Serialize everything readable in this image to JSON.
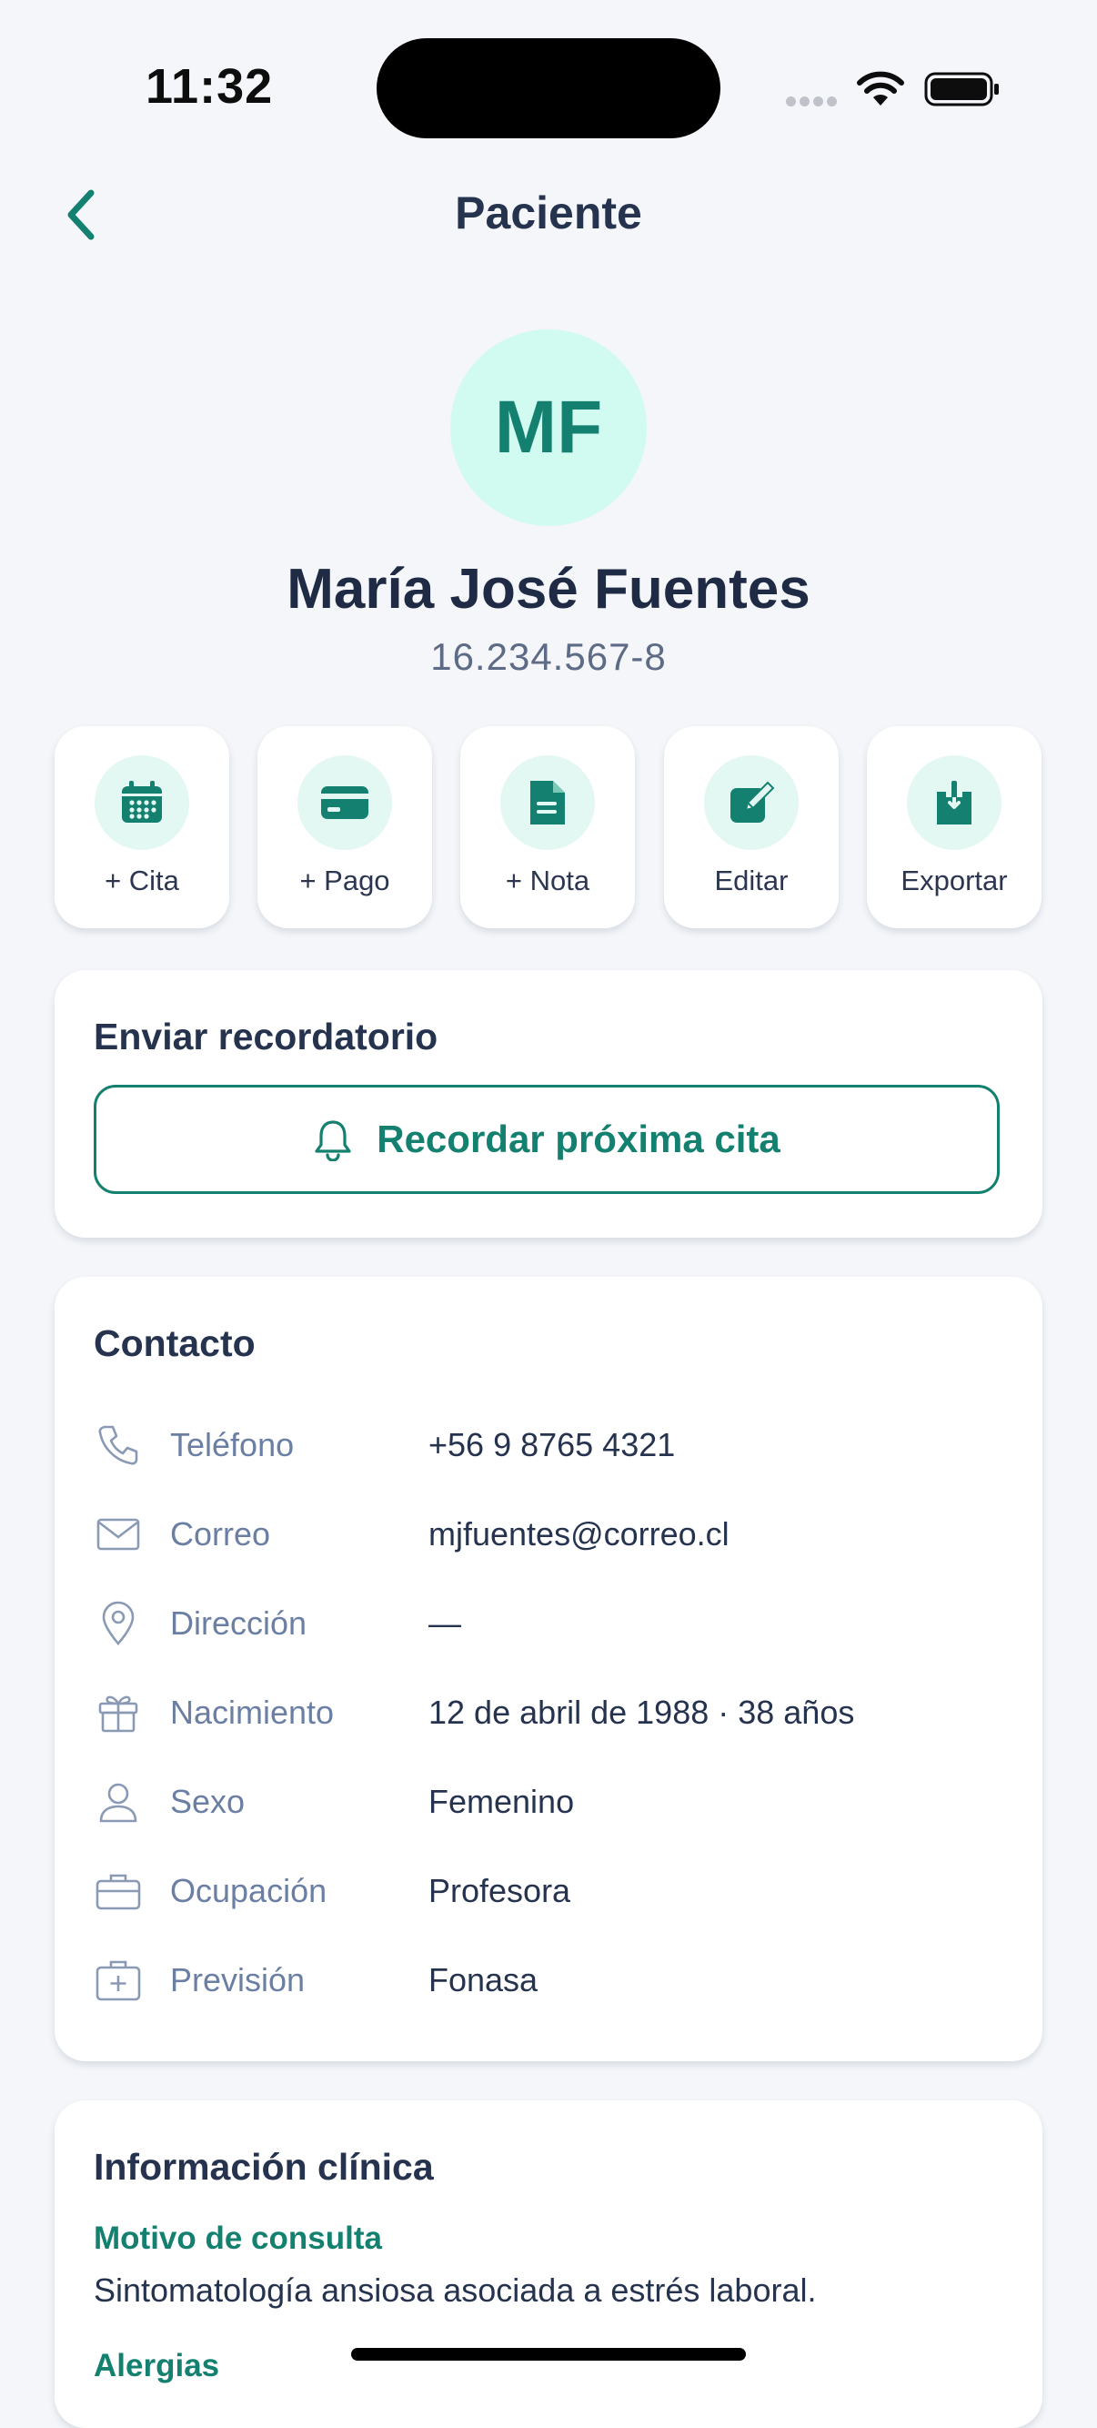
{
  "status_bar": {
    "time": "11:32"
  },
  "nav": {
    "title": "Paciente",
    "back_icon": "chevron-left-icon"
  },
  "patient": {
    "initials": "MF",
    "name": "María José Fuentes",
    "rut": "16.234.567-8"
  },
  "actions": [
    {
      "label": "+ Cita",
      "icon": "calendar-icon"
    },
    {
      "label": "+ Pago",
      "icon": "credit-card-icon"
    },
    {
      "label": "+ Nota",
      "icon": "document-icon"
    },
    {
      "label": "Editar",
      "icon": "edit-icon"
    },
    {
      "label": "Exportar",
      "icon": "download-icon"
    }
  ],
  "reminder": {
    "title": "Enviar recordatorio",
    "button_label": "Recordar próxima cita",
    "icon": "bell-icon"
  },
  "contact": {
    "title": "Contacto",
    "rows": [
      {
        "label": "Teléfono",
        "value": "+56 9 8765 4321",
        "icon": "phone-icon"
      },
      {
        "label": "Correo",
        "value": "mjfuentes@correo.cl",
        "icon": "mail-icon"
      },
      {
        "label": "Dirección",
        "value": "—",
        "icon": "location-pin-icon"
      },
      {
        "label": "Nacimiento",
        "value": "12 de abril de 1988 · 38 años",
        "icon": "gift-icon"
      },
      {
        "label": "Sexo",
        "value": "Femenino",
        "icon": "user-icon"
      },
      {
        "label": "Ocupación",
        "value": "Profesora",
        "icon": "briefcase-icon"
      },
      {
        "label": "Previsión",
        "value": "Fonasa",
        "icon": "medical-kit-icon"
      }
    ]
  },
  "clinical": {
    "title": "Información clínica",
    "reason_label": "Motivo de consulta",
    "reason_text": "Sintomatología ansiosa asociada a estrés laboral.",
    "allergies_label": "Alergias"
  },
  "colors": {
    "accent": "#14806f",
    "accent_light": "#e4f8f3",
    "avatar_bg": "#d1faf0",
    "background": "#f4f6f9"
  }
}
